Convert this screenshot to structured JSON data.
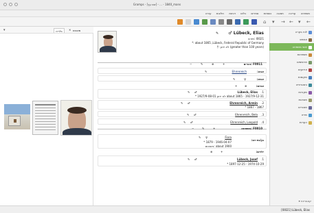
{
  "window": {
    "title": "Gramps - [שם עץ] - ... - 1840_mans"
  },
  "menubar": {
    "items": [
      "משפחה",
      "עריכה",
      "תצוגה",
      "נוספות",
      "ספרים",
      "כלים",
      "דוחות",
      "חלונות",
      "עזרה"
    ]
  },
  "sidebar": {
    "items": [
      {
        "label": "לוח בקרה",
        "color": "#5b8dd6"
      },
      {
        "label": "אנשים",
        "color": "#8a6a45"
      },
      {
        "label": "יחסי משפחה",
        "color": "#7cb85a",
        "active": true
      },
      {
        "label": "משפחות",
        "color": "#c98a3a"
      },
      {
        "label": "תרשימים",
        "color": "#7a9a6a"
      },
      {
        "label": "אירועים",
        "color": "#b04545"
      },
      {
        "label": "מקומות",
        "color": "#4a7fbf"
      },
      {
        "label": "גיאוגרפיה",
        "color": "#3c8a9a"
      },
      {
        "label": "מקורות",
        "color": "#8a5aa8"
      },
      {
        "label": "מובאות",
        "color": "#9a9a6a"
      },
      {
        "label": "מאגרים",
        "color": "#6a6a9a"
      },
      {
        "label": "מדיה",
        "color": "#4a9ad0"
      },
      {
        "label": "הערות",
        "color": "#d0b04a"
      }
    ],
    "bottom_label": "קטגוריות"
  },
  "gallery": {
    "tabs": [
      "גלריה",
      "מוצגים"
    ],
    "close_label": "×"
  },
  "person": {
    "name": "Lübeck, Elias",
    "gender_symbol": "♂",
    "id_label": "I0021 :מזהה",
    "birth": "about 1865 ,Lübeck, Federal Republic of Germany :*",
    "death": "(greater than 100 years) לא ידוע :†"
  },
  "parents": {
    "family_id": "F0011 :הורים",
    "father_label": "אבא:",
    "father_name": "Ehrenreich",
    "mother_label": "אמא:",
    "mother_name": "",
    "siblings_label": "אחים:",
    "siblings": [
      {
        "num": "1.",
        "name": "Lübeck, Elias",
        "dates": "about 1865 - 1927/9-12-31 לא ידוע 1927/9-08-01 *"
      },
      {
        "num": "2.",
        "name": "Ehrenreich, Armin",
        "dates": "1867 - 1867 *"
      },
      {
        "num": "3.",
        "name": "Ehrenreich, Bela",
        "dates": ""
      },
      {
        "num": "4.",
        "name": "Ehrenreich, Leopold",
        "dates": ""
      }
    ]
  },
  "family": {
    "family_id": "F0010 :משפחה",
    "spouse_label": "בן/בת זוג:",
    "spouse_name": "Fiora",
    "spouse_dates": "1946-04-07 - 1879 *",
    "spouse_extra": "about 1900 :נישואים",
    "children_label": "ילדים:",
    "children": [
      {
        "num": "1.",
        "name": "Lübeck, Josef",
        "dates": "1974-10-29 - 1897-12-25 *"
      }
    ]
  },
  "statusbar": {
    "text": "[I0021] Lübeck, Elias"
  }
}
